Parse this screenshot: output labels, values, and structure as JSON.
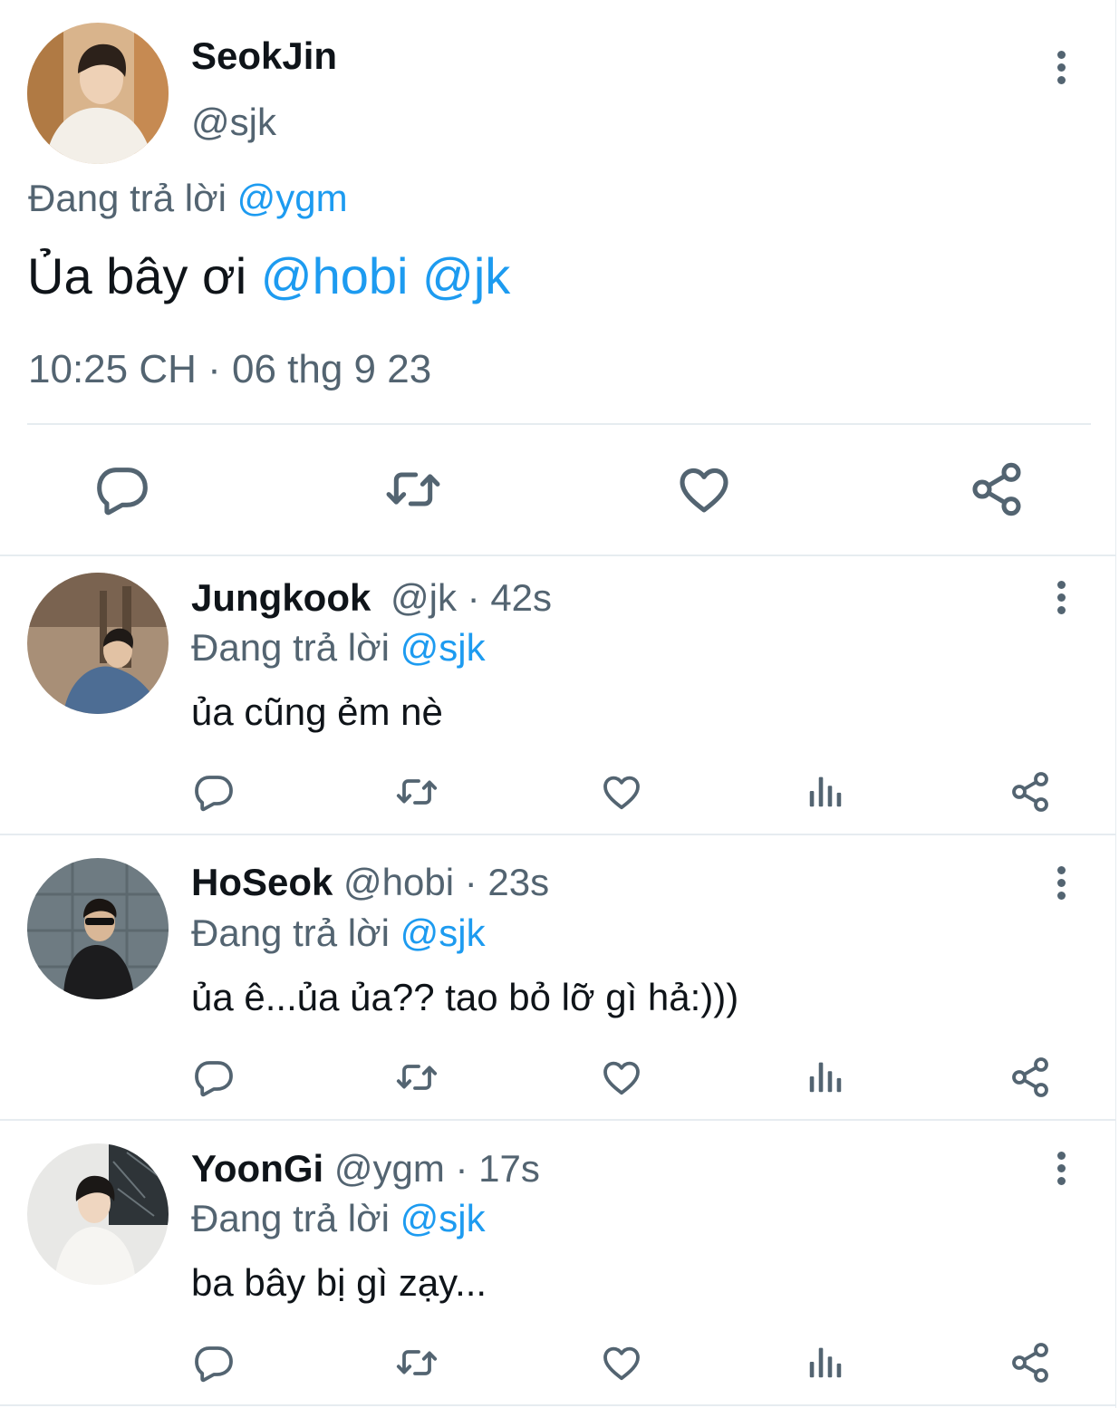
{
  "main_tweet": {
    "display_name": "SeokJin",
    "handle": "@sjk",
    "replying_prefix": "Đang trả lời",
    "replying_to": "@ygm",
    "text": "Ủa bây ơi",
    "mentions": [
      "@hobi",
      "@jk"
    ],
    "timestamp": "10:25 CH · 06 thg 9 23"
  },
  "replies": [
    {
      "display_name": "Jungkook",
      "handle": "@jk",
      "time": "· 42s",
      "replying_prefix": "Đang trả lời",
      "replying_to": "@sjk",
      "text": "ủa cũng ẻm nè"
    },
    {
      "display_name": "HoSeok",
      "handle": "@hobi",
      "time": "· 23s",
      "replying_prefix": "Đang trả lời",
      "replying_to": "@sjk",
      "text": "ủa ê...ủa ủa?? tao bỏ lỡ gì hả:)))"
    },
    {
      "display_name": "YoonGi",
      "handle": "@ygm",
      "time": "· 17s",
      "replying_prefix": "Đang trả lời",
      "replying_to": "@sjk",
      "text": "ba bây bị gì zạy..."
    }
  ],
  "icons": {
    "reply": "reply-icon",
    "retweet": "retweet-icon",
    "like": "heart-icon",
    "views": "views-icon",
    "share": "share-icon",
    "more": "more-options-icon"
  },
  "colors": {
    "link": "#1d9bf0",
    "secondary_text": "#536471",
    "primary_text": "#0f1419",
    "divider": "#e6ecf0"
  }
}
